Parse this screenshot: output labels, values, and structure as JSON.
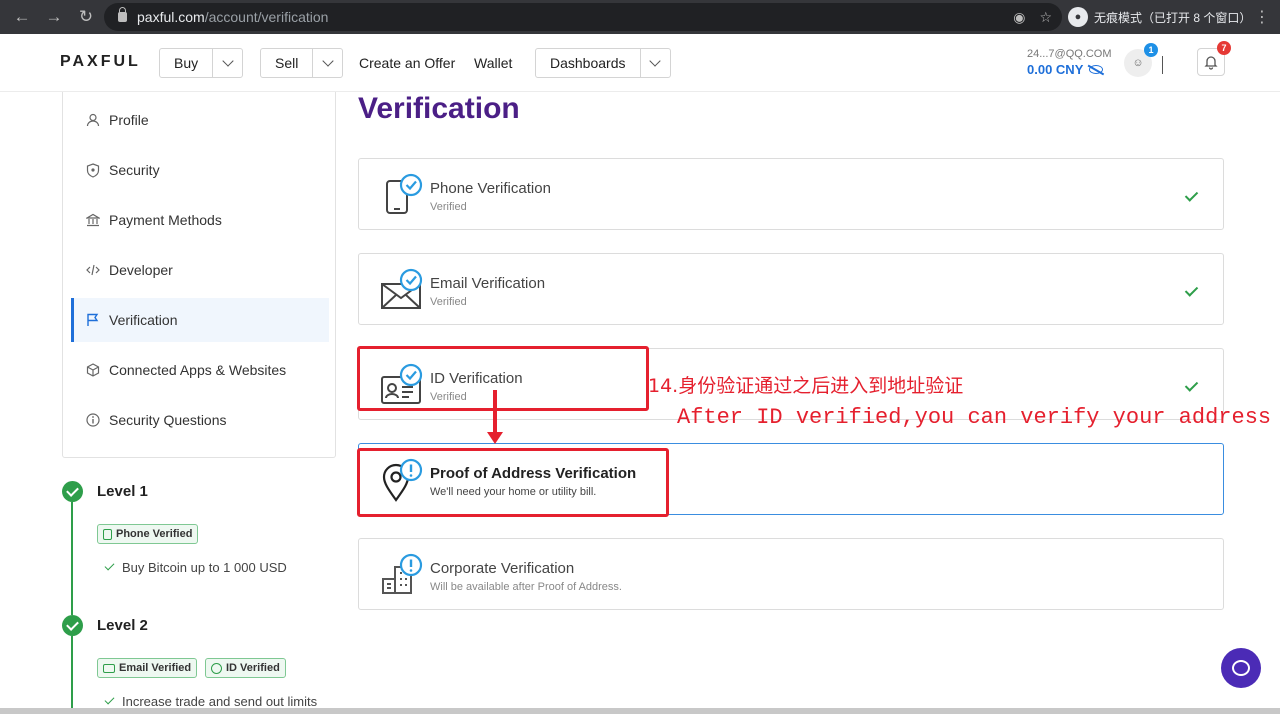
{
  "browser": {
    "url_host": "paxful.com",
    "url_path": "/account/verification",
    "incognito_label": "无痕模式（已打开 8 个窗口）"
  },
  "nav": {
    "logo": "PAXFUL",
    "buy": "Buy",
    "sell": "Sell",
    "create_offer": "Create an Offer",
    "wallet": "Wallet",
    "dashboards": "Dashboards",
    "account_email": "24...7@QQ.COM",
    "balance": "0.00 CNY",
    "account_badge": "1",
    "notifications_badge": "7"
  },
  "sidebar": {
    "items": [
      {
        "label": "Profile",
        "icon": "user-icon"
      },
      {
        "label": "Security",
        "icon": "shield-icon"
      },
      {
        "label": "Payment Methods",
        "icon": "bank-icon"
      },
      {
        "label": "Developer",
        "icon": "code-icon"
      },
      {
        "label": "Verification",
        "icon": "flag-icon",
        "active": true
      },
      {
        "label": "Connected Apps & Websites",
        "icon": "cube-icon"
      },
      {
        "label": "Security Questions",
        "icon": "info-icon"
      }
    ]
  },
  "levels": [
    {
      "title": "Level 1",
      "chips": [
        "Phone Verified"
      ],
      "perks": [
        "Buy Bitcoin up to 1 000 USD"
      ]
    },
    {
      "title": "Level 2",
      "chips": [
        "Email Verified",
        "ID Verified"
      ],
      "perks": [
        "Increase trade and send out limits"
      ]
    }
  ],
  "main": {
    "title": "Verification",
    "cards": [
      {
        "title": "Phone Verification",
        "subtitle": "Verified",
        "status": "verified",
        "icon": "phone-icon"
      },
      {
        "title": "Email Verification",
        "subtitle": "Verified",
        "status": "verified",
        "icon": "envelope-icon"
      },
      {
        "title": "ID Verification",
        "subtitle": "Verified",
        "status": "verified",
        "icon": "id-card-icon"
      },
      {
        "title": "Proof of Address Verification",
        "subtitle": "We'll need your home or utility bill.",
        "status": "pending",
        "icon": "map-pin-icon"
      },
      {
        "title": "Corporate Verification",
        "subtitle": "Will be available after Proof of Address.",
        "status": "locked",
        "icon": "building-icon"
      }
    ]
  },
  "annotation": {
    "chinese": "14.身份验证通过之后进入到地址验证",
    "english": "After ID verified,you can verify your address"
  },
  "colors": {
    "brand_purple": "#4b1f86",
    "accent_blue": "#1e6fd9",
    "success_green": "#2e9e4a",
    "annotation_red": "#e5202e"
  }
}
